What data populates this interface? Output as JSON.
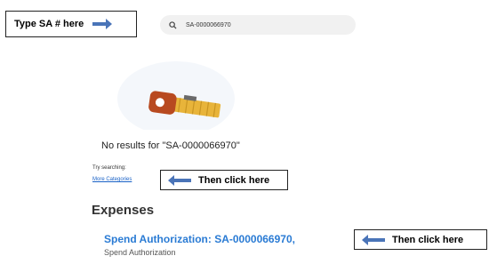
{
  "callouts": {
    "type_sa": "Type SA # here",
    "then_click_1": "Then click here",
    "then_click_2": "Then click here"
  },
  "search": {
    "value": "SA-0000066970",
    "icon": "search-icon"
  },
  "empty_state": {
    "message": "No results for \"SA-0000066970\"",
    "illustration": "key-icon"
  },
  "suggestions": {
    "try_label": "Try searching:",
    "more_categories": "More Categories"
  },
  "results": {
    "section_title": "Expenses",
    "items": [
      {
        "title": "Spend Authorization: SA-0000066970,",
        "subtitle": "Spend Authorization"
      }
    ]
  },
  "colors": {
    "arrow": "#4a74b8",
    "link": "#2a7bd4",
    "key_body": "#e8b43a",
    "key_head": "#b84a20"
  }
}
